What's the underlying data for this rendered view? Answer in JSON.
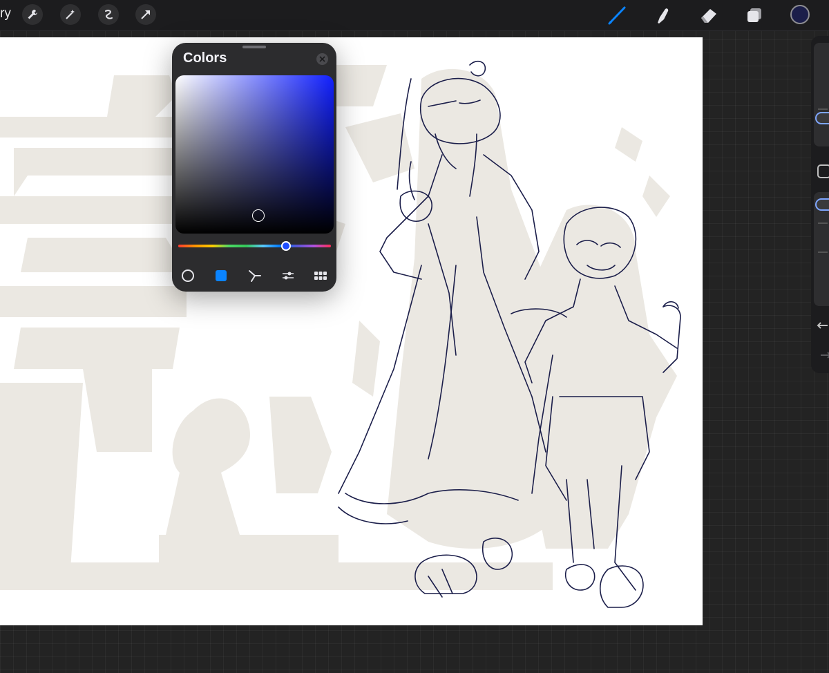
{
  "toolbar": {
    "gallery_label": "ry",
    "left_tools": [
      "wrench-icon",
      "magic-wand-icon",
      "selection-icon",
      "transform-arrow-icon"
    ],
    "right_tools": [
      "brush-icon",
      "smudge-icon",
      "eraser-icon",
      "layers-icon"
    ],
    "active_tool": "brush-icon",
    "current_color": "#1b1e4a",
    "accent": "#0a84ff"
  },
  "colors_panel": {
    "title": "Colors",
    "close_icon": "close-icon",
    "selected_hue_color": "#1120ff",
    "hue_position": 0.72,
    "modes": [
      "disc-mode-icon",
      "classic-mode-icon",
      "harmony-mode-icon",
      "value-mode-icon",
      "palettes-mode-icon"
    ],
    "active_mode": "classic-mode-icon"
  },
  "sidebar": {
    "controls": [
      "brush-size-slider",
      "modify-button",
      "opacity-slider",
      "undo-icon",
      "redo-icon"
    ]
  }
}
